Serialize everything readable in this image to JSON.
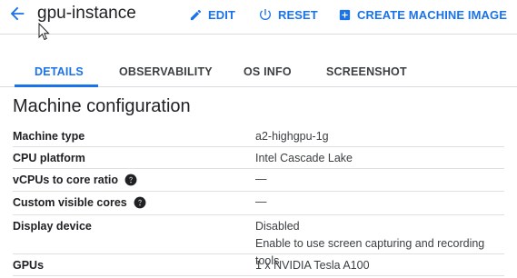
{
  "header": {
    "title": "gpu-instance",
    "back_icon": "arrow-back-icon",
    "buttons": {
      "edit": "EDIT",
      "reset": "RESET",
      "create_machine_image": "CREATE MACHINE IMAGE"
    }
  },
  "tabs": [
    {
      "label": "DETAILS",
      "active": true
    },
    {
      "label": "OBSERVABILITY",
      "active": false
    },
    {
      "label": "OS INFO",
      "active": false
    },
    {
      "label": "SCREENSHOT",
      "active": false
    }
  ],
  "section": {
    "title": "Machine configuration",
    "rows": [
      {
        "label": "Machine type",
        "value": "a2-highgpu-1g"
      },
      {
        "label": "CPU platform",
        "value": "Intel Cascade Lake"
      },
      {
        "label": "vCPUs to core ratio",
        "value": "—",
        "help": true
      },
      {
        "label": "Custom visible cores",
        "value": "—",
        "help": true
      },
      {
        "label": "Display device",
        "value": "Disabled",
        "value2": "Enable to use screen capturing and recording tools"
      },
      {
        "label": "GPUs",
        "value": "1 x NVIDIA Tesla A100"
      }
    ]
  },
  "colors": {
    "accent": "#1a73e8",
    "text": "#202124",
    "divider": "#dadce0"
  }
}
